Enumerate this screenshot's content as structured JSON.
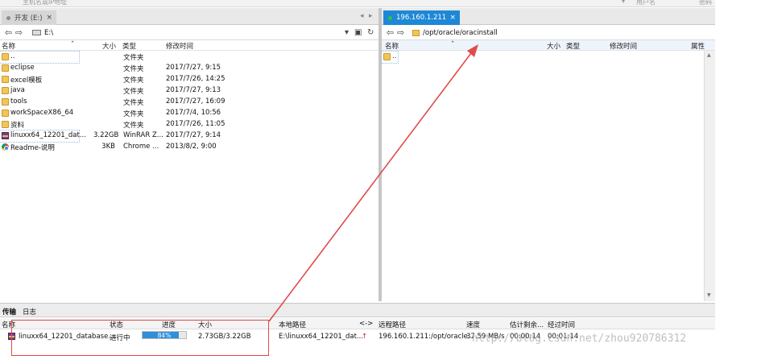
{
  "host_bar": {
    "host_placeholder": "主机名或IP地址",
    "user_placeholder": "用户名",
    "pass_placeholder": "密码"
  },
  "local": {
    "tab_label": "开发 (E:)",
    "path": "E:\\",
    "columns": {
      "name": "名称",
      "size": "大小",
      "type": "类型",
      "modified": "修改时间"
    },
    "files": [
      {
        "icon": "folder-icon",
        "name": "..",
        "size": "",
        "type": "文件夹",
        "modified": ""
      },
      {
        "icon": "folder-icon",
        "name": "eclipse",
        "size": "",
        "type": "文件夹",
        "modified": "2017/7/27, 9:15"
      },
      {
        "icon": "folder-icon",
        "name": "excel模板",
        "size": "",
        "type": "文件夹",
        "modified": "2017/7/26, 14:25"
      },
      {
        "icon": "folder-icon",
        "name": "java",
        "size": "",
        "type": "文件夹",
        "modified": "2017/7/27, 9:13"
      },
      {
        "icon": "folder-icon",
        "name": "tools",
        "size": "",
        "type": "文件夹",
        "modified": "2017/7/27, 16:09"
      },
      {
        "icon": "folder-icon",
        "name": "workSpaceX86_64",
        "size": "",
        "type": "文件夹",
        "modified": "2017/7/4, 10:56"
      },
      {
        "icon": "folder-icon",
        "name": "资料",
        "size": "",
        "type": "文件夹",
        "modified": "2017/7/26, 11:05"
      },
      {
        "icon": "rar-icon",
        "name": "linuxx64_12201_dat...",
        "size": "3.22GB",
        "type": "WinRAR Z...",
        "modified": "2017/7/27, 9:14"
      },
      {
        "icon": "chrome-icon",
        "name": "Readme-说明",
        "size": "3KB",
        "type": "Chrome ...",
        "modified": "2013/8/2, 9:00"
      }
    ]
  },
  "remote": {
    "tab_label": "196.160.1.211",
    "status_color": "#29c24a",
    "path": "/opt/oracle/oracinstall",
    "columns": {
      "name": "名称",
      "size": "大小",
      "type": "类型",
      "modified": "修改时间",
      "attr": "属性"
    },
    "files": [
      {
        "icon": "folder-icon",
        "name": ".."
      }
    ]
  },
  "bottom": {
    "tabs": [
      "传输",
      "日志"
    ],
    "columns": {
      "name": "名称",
      "status": "状态",
      "progress": "进度",
      "size": "大小",
      "local": "本地路径",
      "dir": "<->",
      "remote": "远程路径",
      "speed": "速度",
      "eta": "估计剩余...",
      "elapsed": "经过时间"
    },
    "transfer": {
      "name": "linuxx64_12201_database....",
      "status": "进行中",
      "progress_percent": 84,
      "progress_label": "84%",
      "size": "2.73GB/3.22GB",
      "local": "E:\\linuxx64_12201_dat...",
      "remote": "196.160.1.211:/opt/oracle...",
      "speed": "37.59 MB/s",
      "eta": "00:00:14",
      "elapsed": "00:01:14"
    }
  },
  "watermark": "http://blog.csdn.net/zhou920786312",
  "colors": {
    "annotation_red": "#e24a4a",
    "accent_blue": "#1e88d6"
  }
}
